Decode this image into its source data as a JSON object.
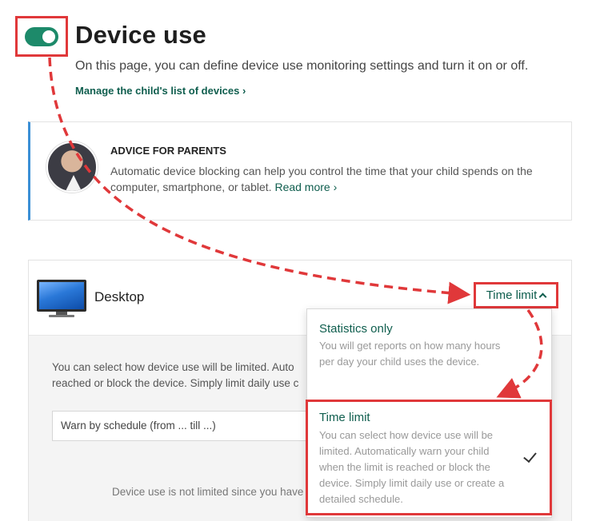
{
  "header": {
    "title": "Device use",
    "subtitle": "On this page, you can define device use monitoring settings and turn it on or off.",
    "manage_link": "Manage the child's list of devices ›",
    "toggle_on": true
  },
  "advice": {
    "heading": "ADVICE FOR PARENTS",
    "text": "Automatic device blocking can help you control the time that your child spends on the computer, smartphone, or tablet.",
    "link": "Read more ›"
  },
  "device": {
    "name": "Desktop",
    "limit_mode": "Time limit",
    "body_text_line1": "You can select how device use will be limited. Auto",
    "body_text_line2": "reached or block the device. Simply limit daily use c",
    "schedule_select": "Warn by schedule (from ... till ...)",
    "note": "Device use is not limited since you have"
  },
  "dropdown": {
    "options": [
      {
        "title": "Statistics only",
        "desc": "You will get reports on how many hours per day your child uses the device."
      },
      {
        "title": "Time limit",
        "desc": "You can select how device use will be limited. Automatically warn your child when the limit is reached or block the device. Simply limit daily use or create a detailed schedule.",
        "selected": true
      }
    ]
  },
  "colors": {
    "accent_green": "#0f5e4e",
    "toggle_green": "#1d8a6a",
    "annotation_red": "#e0383a",
    "advice_border_blue": "#3b8fd6"
  }
}
